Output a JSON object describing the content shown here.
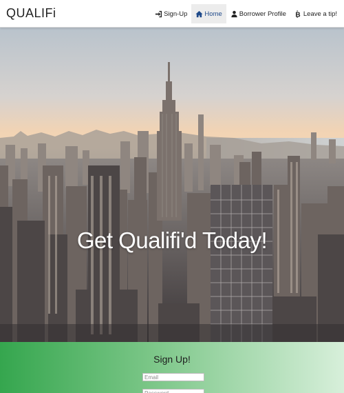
{
  "navbar": {
    "brand": "QUALIFi",
    "links": [
      {
        "label": "Sign-Up",
        "icon": "sign-in-icon",
        "active": false
      },
      {
        "label": "Home",
        "icon": "home-icon",
        "active": true
      },
      {
        "label": "Borrower Profile",
        "icon": "user-icon",
        "active": false
      },
      {
        "label": "Leave a tip!",
        "icon": "bitcoin-icon",
        "active": false
      }
    ]
  },
  "hero": {
    "title": "Get Qualifi'd Today!",
    "image": "new-york-skyline-photo"
  },
  "signup": {
    "title": "Sign Up!",
    "email_placeholder": "Email",
    "password_placeholder": "Password"
  },
  "colors": {
    "active_nav": "#1f4a8a",
    "signup_gradient_start": "#35a64e",
    "signup_gradient_end": "#d7efda"
  }
}
